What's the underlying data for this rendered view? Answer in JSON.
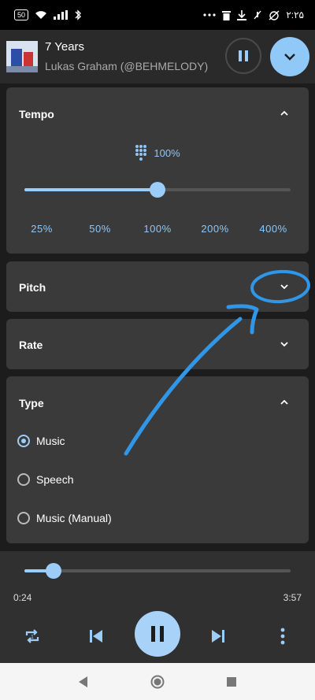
{
  "status_bar": {
    "battery": "50",
    "time": "۲:۲۵",
    "icons": [
      "battery-icon",
      "wifi-icon",
      "signal-icon",
      "bluetooth-icon",
      "more-dots-icon",
      "trash-icon",
      "download-icon",
      "mute-icon",
      "alarm-off-icon"
    ]
  },
  "now_playing": {
    "title": "7 Years",
    "artist": "Lukas Graham (@BEHMELODY)"
  },
  "tempo": {
    "title": "Tempo",
    "value": "100%",
    "slider_fraction": 0.5,
    "presets": [
      "25%",
      "50%",
      "100%",
      "200%",
      "400%"
    ]
  },
  "pitch": {
    "title": "Pitch"
  },
  "rate": {
    "title": "Rate"
  },
  "type": {
    "title": "Type",
    "options": [
      {
        "label": "Music",
        "selected": true
      },
      {
        "label": "Speech",
        "selected": false
      },
      {
        "label": "Music (Manual)",
        "selected": false
      }
    ]
  },
  "player": {
    "elapsed": "0:24",
    "duration": "3:57",
    "progress_fraction": 0.11
  },
  "colors": {
    "accent": "#9ccdf8",
    "card_bg": "#3a3a3a",
    "page_bg": "#1c1c1c",
    "annotation": "#2f96e8"
  }
}
